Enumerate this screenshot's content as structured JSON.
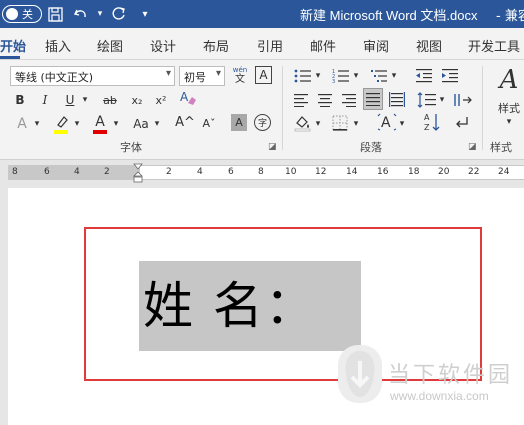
{
  "title_bar": {
    "autosave_toggle": "关",
    "document_title": "新建 Microsoft Word 文档.docx",
    "compat_suffix": "- 兼容",
    "customize_glyph": "▾"
  },
  "tabs": [
    "开始",
    "插入",
    "绘图",
    "设计",
    "布局",
    "引用",
    "邮件",
    "审阅",
    "视图",
    "开发工具"
  ],
  "ribbon": {
    "font_name": "等线 (中文正文)",
    "font_size": "初号",
    "phonetic_top": "wén",
    "phonetic_bottom": "文",
    "border_char": "A",
    "bold": "B",
    "italic": "I",
    "underline": "U",
    "strikethrough": "ab",
    "subscript": "x₂",
    "superscript": "x²",
    "font_color_letter": "A",
    "change_case": "Aa",
    "grow_font": "A^",
    "shrink_font": "Aˇ",
    "char_shading": "A",
    "enclose_char": "字",
    "text_effects": "A",
    "highlight_letter": "ab",
    "font_group_label": "字体",
    "paragraph_group_label": "段落",
    "styles_label": "样式",
    "styles_group_label": "样式",
    "styles_preview": "A"
  },
  "ruler": {
    "left_numbers": [
      "8",
      "6",
      "4",
      "2"
    ],
    "right_numbers": [
      "2",
      "4",
      "6",
      "8",
      "10",
      "12",
      "14",
      "16",
      "18",
      "20",
      "22",
      "24"
    ]
  },
  "document": {
    "text": "姓 名："
  },
  "watermark": {
    "title": "当下软件园",
    "url": "www.downxia.com"
  },
  "colors": {
    "word_blue": "#2b579a",
    "frame_red": "#e03b3b",
    "highlight_yellow": "#ffff00",
    "font_red": "#e00000",
    "text_highlight_gray": "#c6c6c6"
  }
}
